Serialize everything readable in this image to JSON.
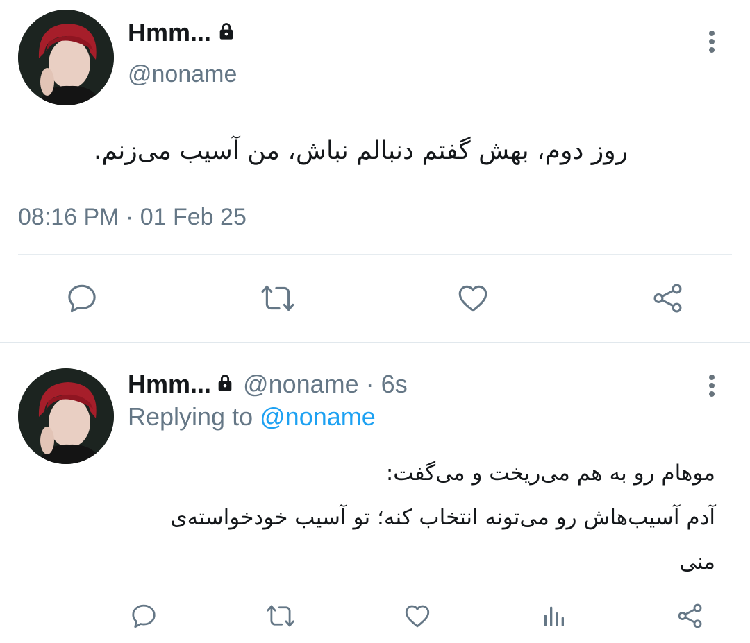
{
  "main_tweet": {
    "display_name": "Hmm...",
    "handle": "@noname",
    "text": "روز دوم، بهش گفتم دنبالم نباش، من آسیب می‌زنم.",
    "timestamp": "08:16 PM · 01 Feb 25",
    "actions": [
      "reply-icon",
      "retweet-icon",
      "like-icon",
      "share-icon"
    ]
  },
  "reply_tweet": {
    "display_name": "Hmm...",
    "handle": "@noname",
    "separator": "·",
    "time_ago": "6s",
    "replying_prefix": "Replying to",
    "replying_to": "@noname",
    "lines": [
      "موهام رو به هم می‌ریخت و می‌گفت:",
      "آدم آسیب‌هاش رو می‌تونه انتخاب کنه؛ تو آسیب خودخواسته‌ی",
      "منی"
    ],
    "actions": [
      "reply-icon",
      "retweet-icon",
      "like-icon",
      "analytics-icon",
      "share-icon"
    ]
  },
  "colors": {
    "text": "#14171a",
    "secondary": "#657786",
    "link": "#1da1f2",
    "divider": "#e6ecf0"
  }
}
